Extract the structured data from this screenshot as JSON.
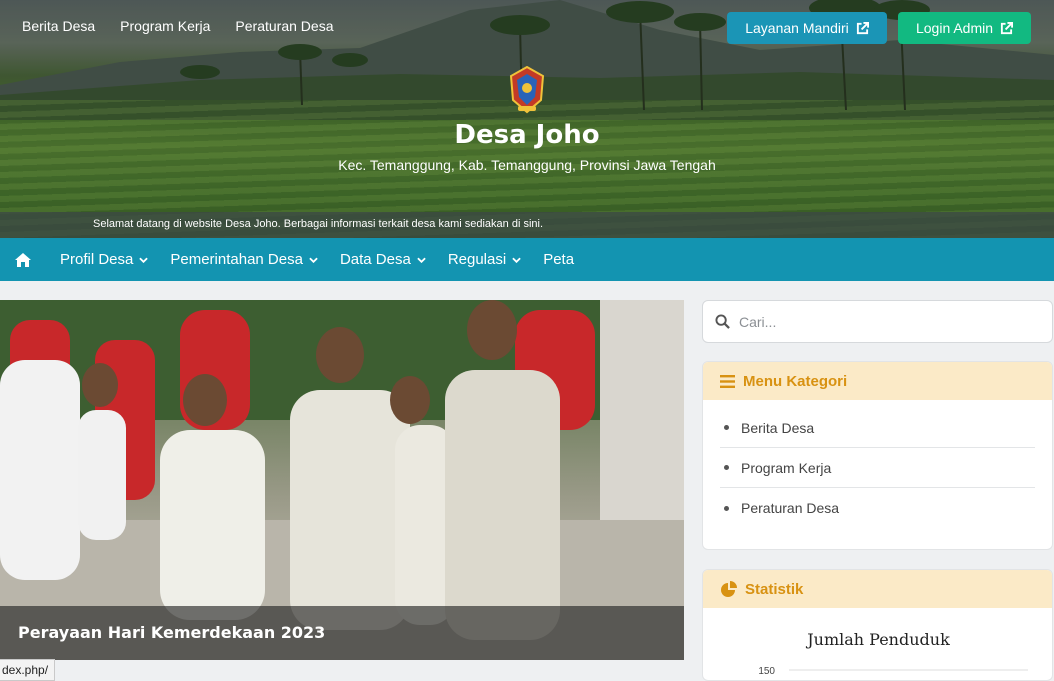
{
  "top_nav": [
    "Berita Desa",
    "Program Kerja",
    "Peraturan Desa"
  ],
  "buttons": {
    "layanan": "Layanan Mandiri",
    "login": "Login Admin"
  },
  "village": {
    "name": "Desa Joho",
    "subtitle": "Kec. Temanggung, Kab. Temanggung, Provinsi Jawa Tengah"
  },
  "ticker": "Selamat datang di website Desa Joho. Berbagai informasi terkait desa kami sediakan di sini.",
  "main_nav": [
    "Profil Desa",
    "Pemerintahan Desa",
    "Data Desa",
    "Regulasi",
    "Peta"
  ],
  "news": {
    "caption": "Perayaan Hari Kemerdekaan 2023"
  },
  "status_url": "dex.php/",
  "search": {
    "placeholder": "Cari..."
  },
  "menu_kategori": {
    "title": "Menu Kategori",
    "items": [
      "Berita Desa",
      "Program Kerja",
      "Peraturan Desa"
    ]
  },
  "statistik": {
    "title": "Statistik"
  },
  "chart_data": {
    "type": "bar",
    "title": "Jumlah Penduduk",
    "y_ticks": [
      150
    ],
    "categories": [],
    "values": []
  },
  "colors": {
    "nav": "#1394b1",
    "layanan": "#1b95b6",
    "login": "#12b981",
    "card_head_bg": "#fbeac7",
    "card_head_text": "#d89212"
  }
}
